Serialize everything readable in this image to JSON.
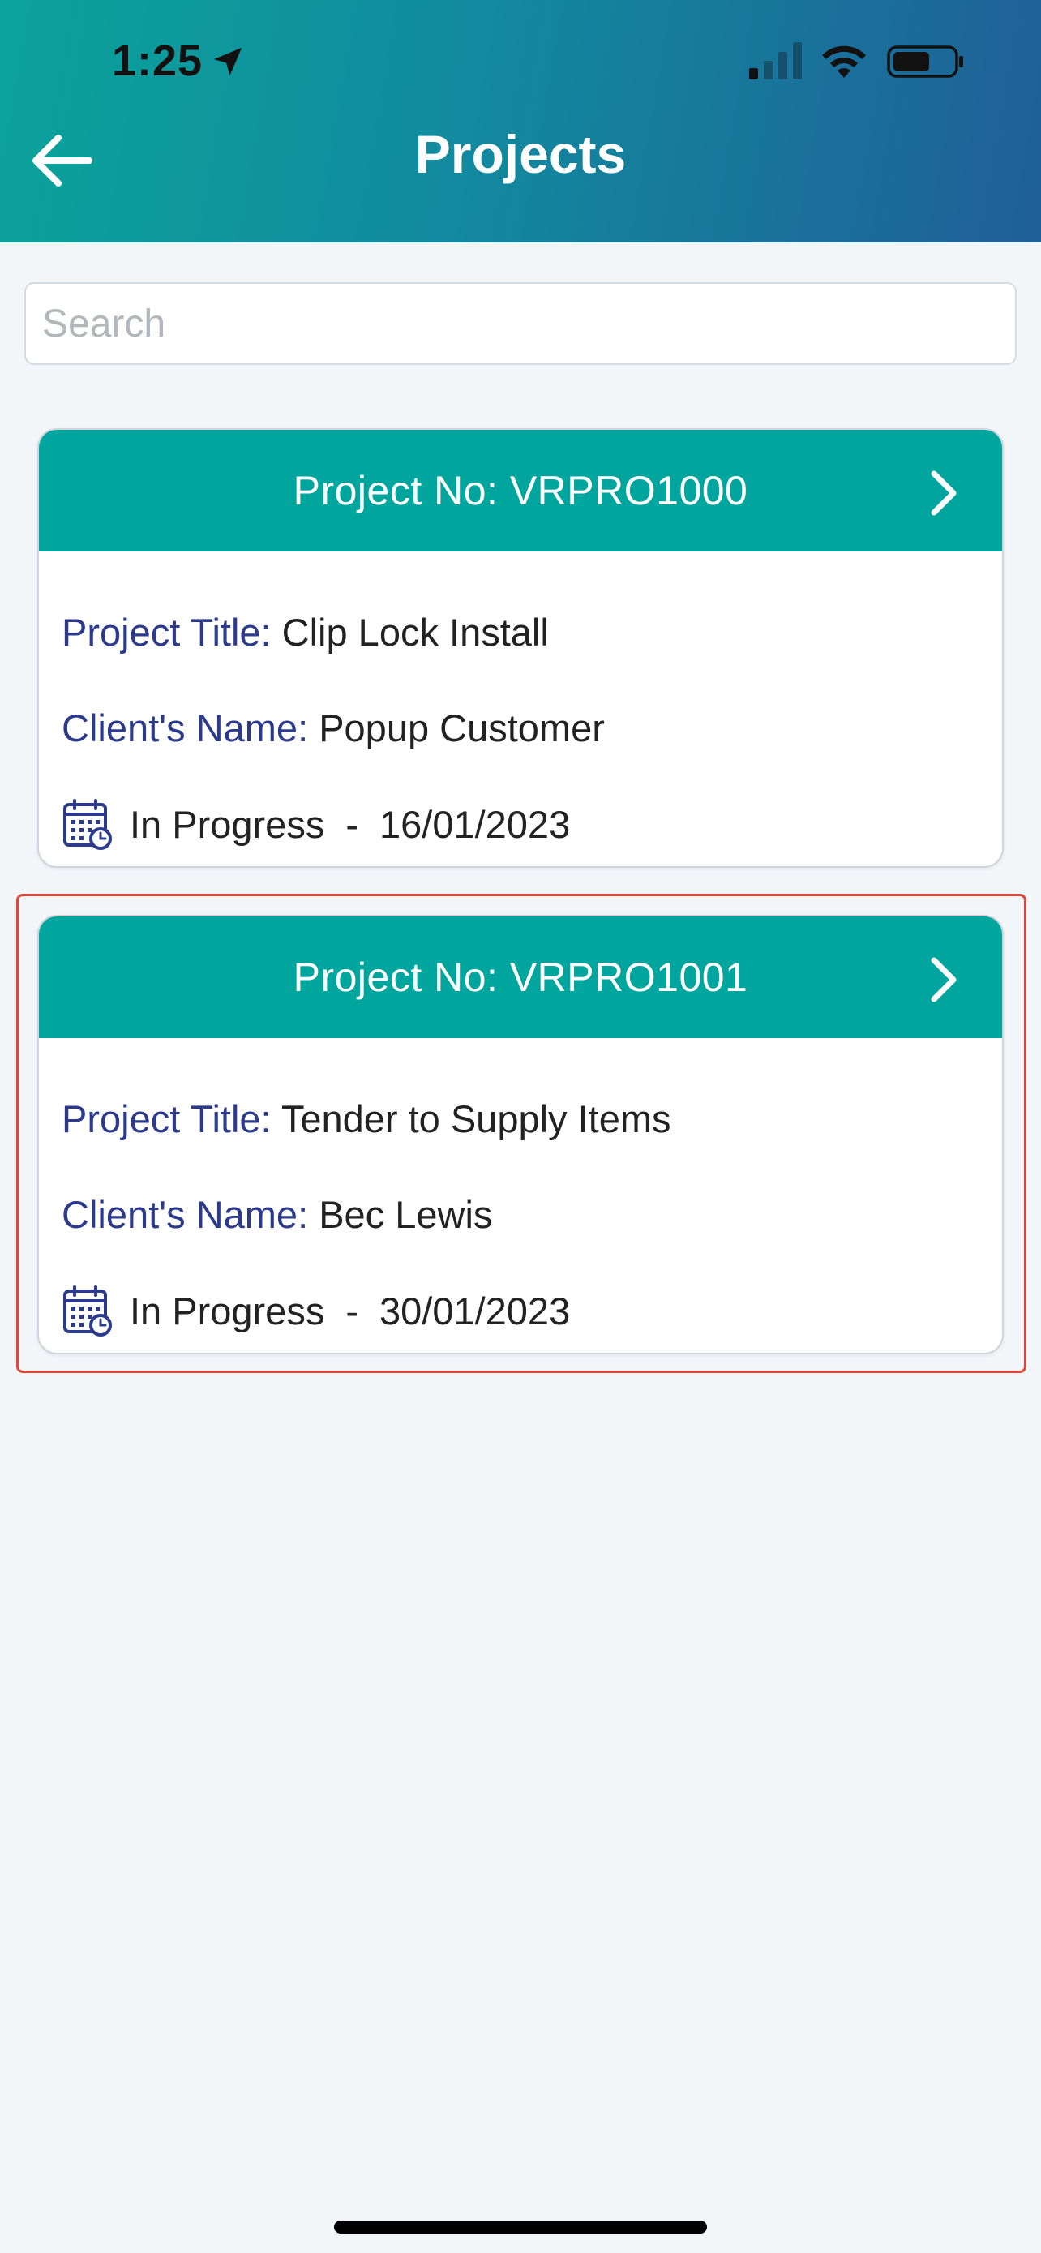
{
  "status_bar": {
    "time": "1:25"
  },
  "nav": {
    "title": "Projects"
  },
  "search": {
    "placeholder": "Search",
    "value": ""
  },
  "projects": [
    {
      "header": "Project No: VRPRO1000",
      "title_label": "Project Title:",
      "title": "Clip Lock Install",
      "client_label": "Client's Name:",
      "client": "Popup Customer",
      "status": "In Progress",
      "separator": "-",
      "date": "16/01/2023",
      "highlighted": false
    },
    {
      "header": "Project No: VRPRO1001",
      "title_label": "Project Title:",
      "title": "Tender to Supply Items",
      "client_label": "Client's Name:",
      "client": "Bec Lewis",
      "status": "In Progress",
      "separator": "-",
      "date": "30/01/2023",
      "highlighted": true
    }
  ],
  "colors": {
    "header_gradient_start": "#0aa39a",
    "header_gradient_end": "#1f5f97",
    "card_header": "#00a69d",
    "label_text": "#2c3a8c",
    "highlight_border": "#e0463a",
    "background": "#f2f6f9"
  },
  "icons": {
    "back": "arrow-left-icon",
    "location": "location-arrow-icon",
    "signal": "cellular-signal-icon",
    "wifi": "wifi-icon",
    "battery": "battery-icon",
    "chevron": "chevron-right-icon",
    "calendar": "calendar-clock-icon"
  }
}
